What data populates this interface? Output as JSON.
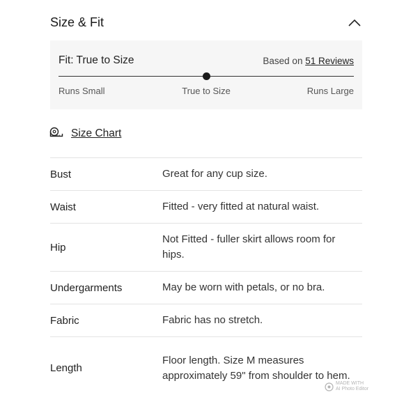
{
  "section": {
    "title": "Size & Fit",
    "collapse_icon": "chevron-up-icon"
  },
  "fit": {
    "label": "Fit: True to Size",
    "reviews_prefix": "Based on",
    "reviews_link": "51 Reviews",
    "scale": {
      "left": "Runs Small",
      "center": "True to Size",
      "right": "Runs Large"
    },
    "position": 0.5
  },
  "size_chart": {
    "label": "Size Chart",
    "icon": "measuring-tape-icon"
  },
  "specs": [
    {
      "name": "Bust",
      "value": "Great for any cup size."
    },
    {
      "name": "Waist",
      "value": "Fitted - very fitted at natural waist."
    },
    {
      "name": "Hip",
      "value": "Not Fitted - fuller skirt allows room for hips."
    },
    {
      "name": "Undergarments",
      "value": "May be worn with petals, or no bra."
    },
    {
      "name": "Fabric",
      "value": "Fabric has no stretch."
    },
    {
      "name": "Length",
      "value": "Floor length. Size M measures approximately 59\" from shoulder to hem."
    }
  ],
  "watermark": {
    "line1": "MADE WITH",
    "line2": "AI Photo Editor"
  }
}
